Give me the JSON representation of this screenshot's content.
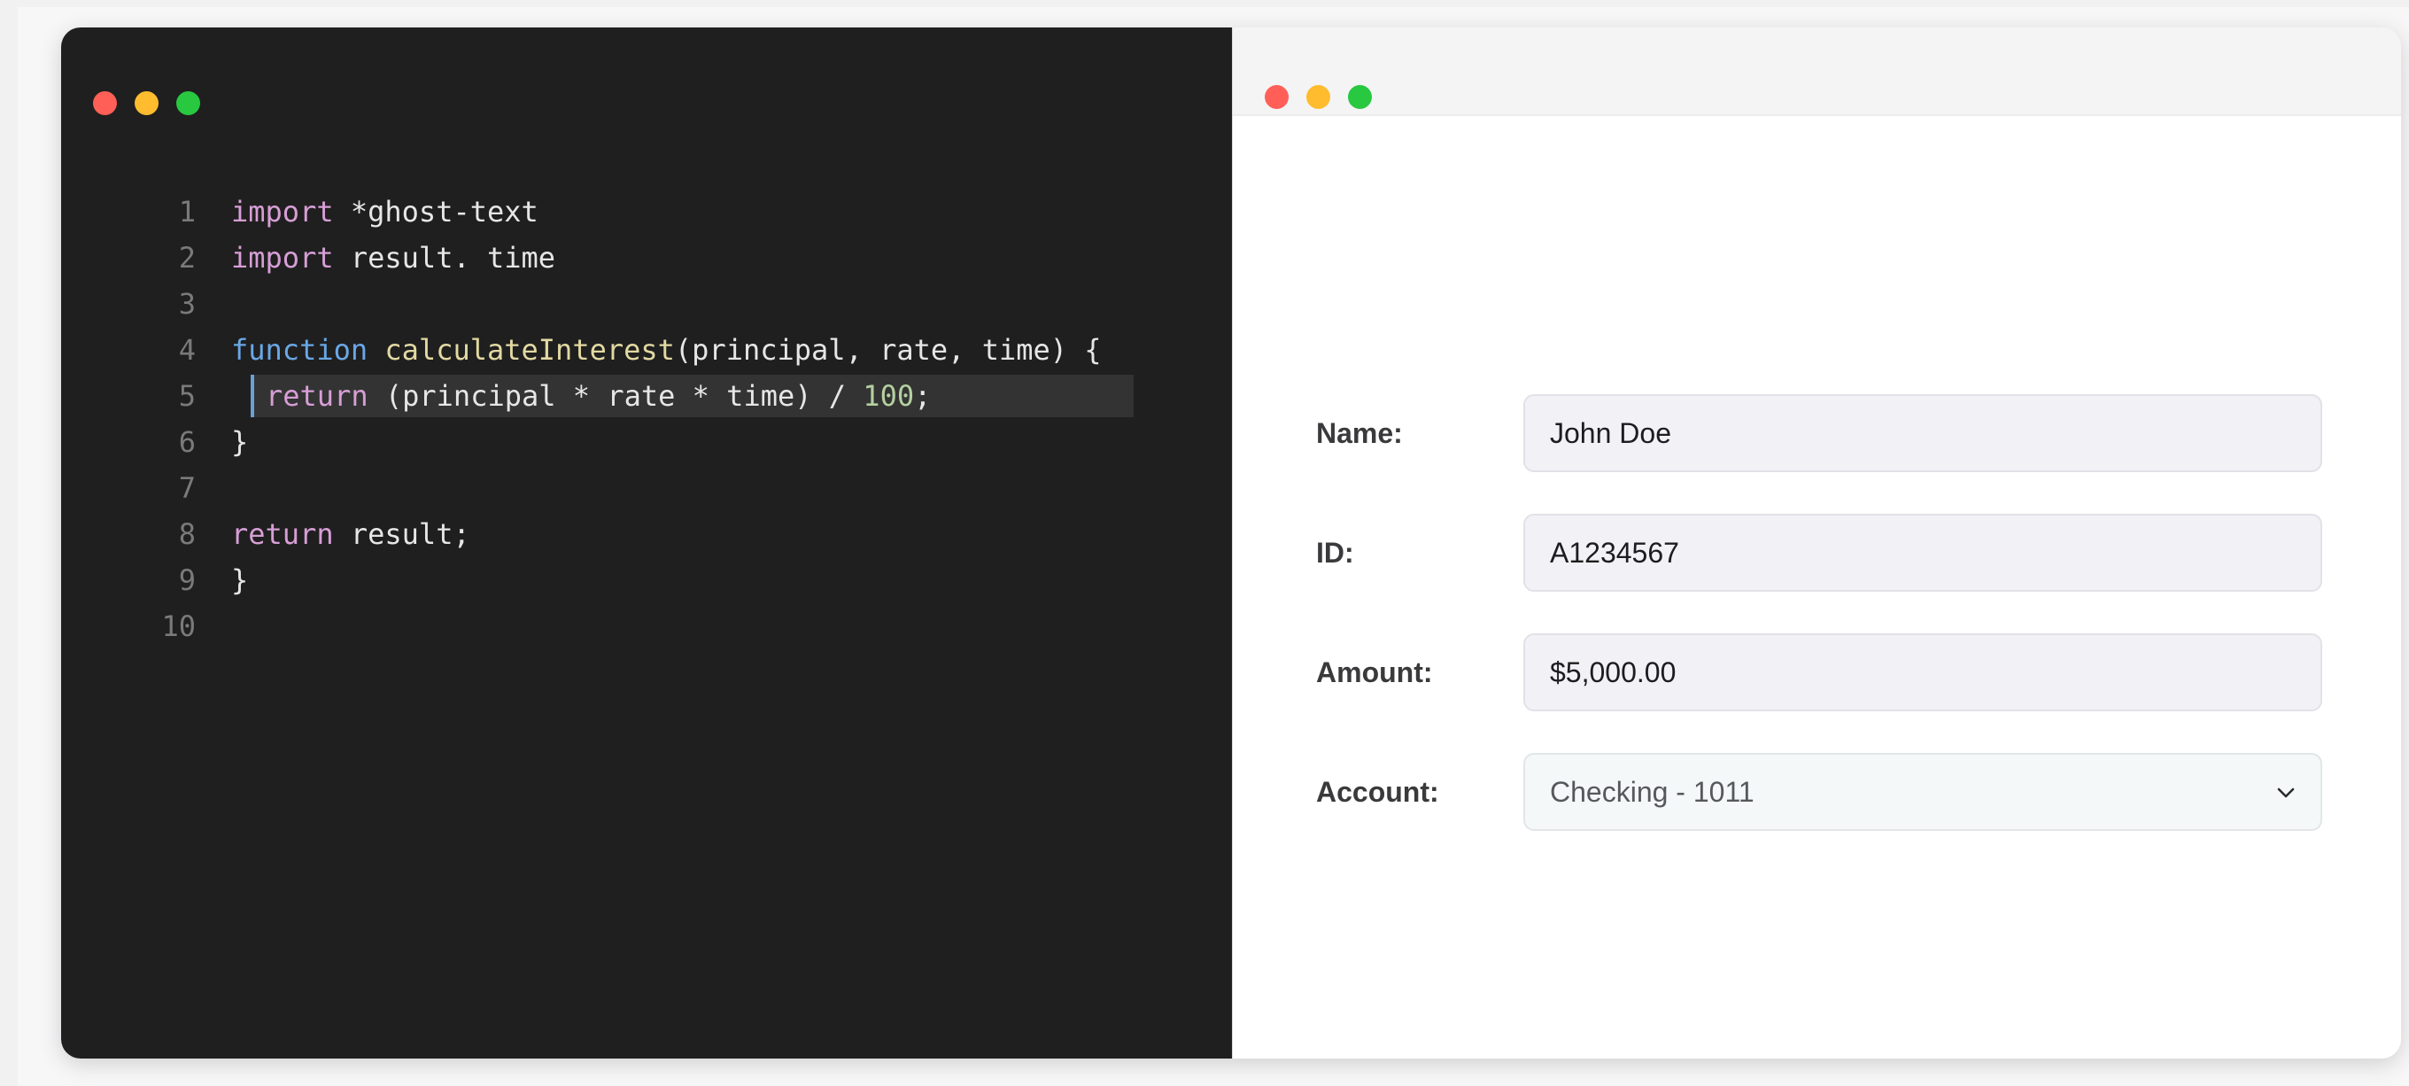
{
  "editor": {
    "lines": [
      {
        "num": "1",
        "tokens": [
          [
            "kw-pink",
            "import"
          ],
          [
            "plain",
            " *ghost-text"
          ]
        ]
      },
      {
        "num": "2",
        "tokens": [
          [
            "kw-pink",
            "import"
          ],
          [
            "plain",
            " result. time"
          ]
        ]
      },
      {
        "num": "3",
        "tokens": []
      },
      {
        "num": "4",
        "tokens": [
          [
            "kw-blue",
            "function"
          ],
          [
            "plain",
            " "
          ],
          [
            "fn",
            "calculateInterest"
          ],
          [
            "plain",
            "(principal, rate, time) {"
          ]
        ]
      },
      {
        "num": "5",
        "active": true,
        "tokens": [
          [
            "kw-pink",
            "return"
          ],
          [
            "plain",
            " (principal * rate * time) / "
          ],
          [
            "num",
            "100"
          ],
          [
            "plain",
            ";"
          ]
        ]
      },
      {
        "num": "6",
        "tokens": [
          [
            "plain",
            "}"
          ]
        ]
      },
      {
        "num": "7",
        "tokens": []
      },
      {
        "num": "8",
        "tokens": [
          [
            "kw-pink",
            "return"
          ],
          [
            "plain",
            " result;"
          ]
        ]
      },
      {
        "num": "9",
        "tokens": [
          [
            "plain",
            "}"
          ]
        ]
      },
      {
        "num": "10",
        "tokens": []
      }
    ]
  },
  "form": {
    "name": {
      "label": "Name:",
      "value": "John Doe"
    },
    "id": {
      "label": "ID:",
      "value": "A1234567"
    },
    "amount": {
      "label": "Amount:",
      "value": "$5,000.00"
    },
    "account": {
      "label": "Account:",
      "value": "Checking - 1011",
      "icon": "chevron-down-icon"
    }
  },
  "colors": {
    "editor_bg": "#1f1f1f",
    "keyword_pink": "#d79ed6",
    "keyword_blue": "#6aa7e6",
    "function_name": "#e2d9a2",
    "number": "#b4d0a0",
    "close_dot": "#ff5f57",
    "minimize_dot": "#febc2e",
    "maximize_dot": "#28c840"
  }
}
